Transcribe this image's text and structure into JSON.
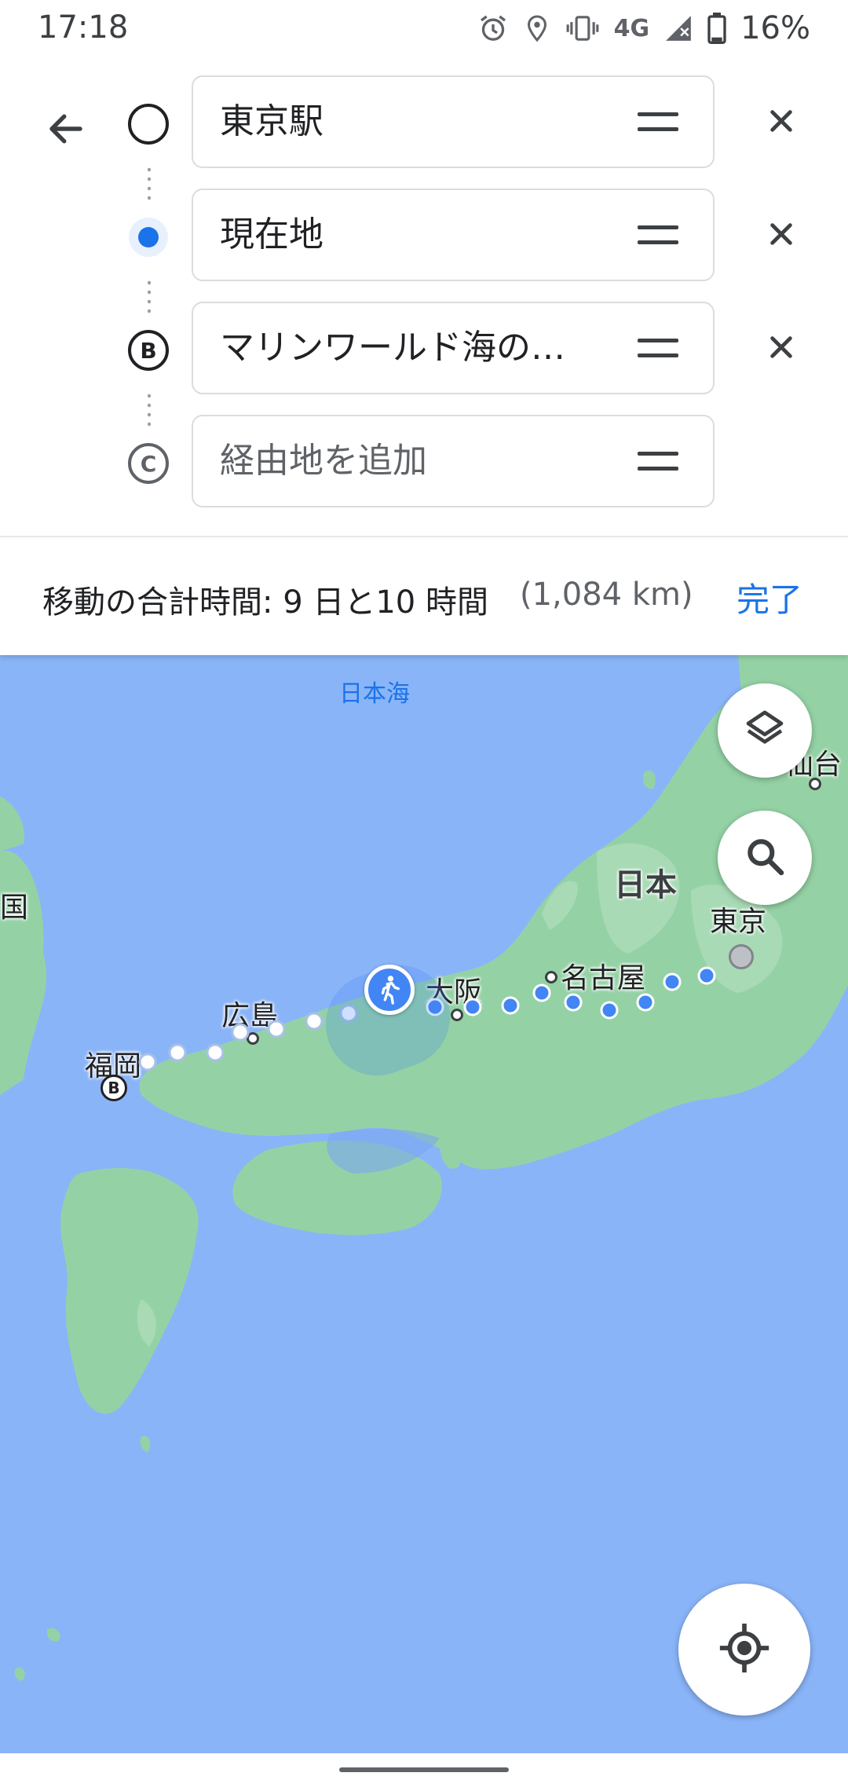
{
  "status_bar": {
    "time": "17:18",
    "network": "4G",
    "battery": "16%",
    "icons": [
      "alarm-icon",
      "location-icon",
      "vibrate-icon",
      "signal-icon",
      "battery-icon"
    ]
  },
  "directions": {
    "stops": [
      {
        "marker": "",
        "marker_icon": "origin-circle-icon",
        "text": "東京駅",
        "placeholder": false
      },
      {
        "marker": "",
        "marker_icon": "current-location-dot-icon",
        "text": "現在地",
        "placeholder": false
      },
      {
        "marker": "B",
        "marker_icon": "stop-b-icon",
        "text": "マリンワールド海の…",
        "placeholder": false
      },
      {
        "marker": "C",
        "marker_icon": "stop-c-icon",
        "text": "経由地を追加",
        "placeholder": true
      }
    ]
  },
  "summary": {
    "total_time": "移動の合計時間: 9 日と10 時間",
    "distance": "(1,084 km)",
    "done_label": "完了"
  },
  "map": {
    "sea_label": "日本海",
    "country_label": "日本",
    "cities": {
      "sendai": "仙台",
      "tokyo": "東京",
      "nagoya": "名古屋",
      "osaka": "大阪",
      "hiroshima": "広島",
      "fukuoka": "福岡",
      "korea_partial": "国"
    },
    "destination_marker": "B",
    "colors": {
      "water": "#8ab4f8",
      "land": "#94d2a5",
      "land_dark": "#a8dab5",
      "route_walked": "#ffffff",
      "route_upcoming": "#4285f4",
      "accent": "#1a73e8"
    }
  }
}
